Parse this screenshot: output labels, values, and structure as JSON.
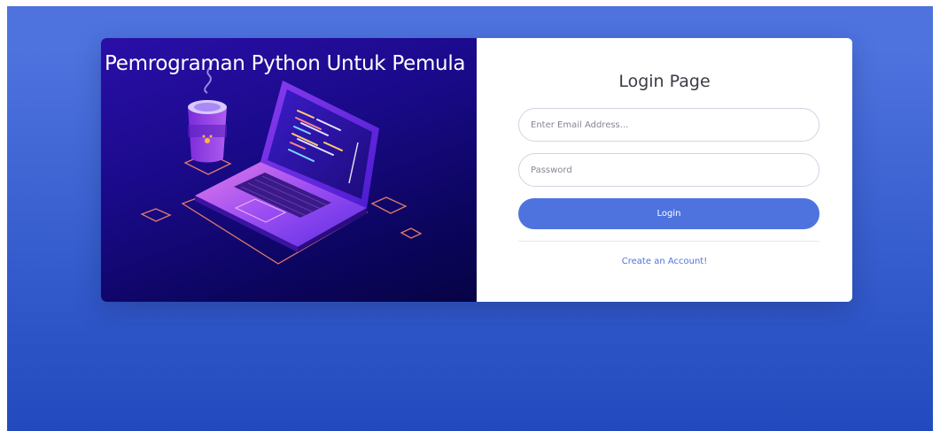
{
  "hero": {
    "title": "Pemrograman Python Untuk Pemula",
    "illustration": "laptop-and-coffee-cup-isometric"
  },
  "login": {
    "title": "Login Page",
    "email_placeholder": "Enter Email Address...",
    "password_placeholder": "Password",
    "login_label": "Login",
    "create_account_label": "Create an Account!"
  },
  "colors": {
    "page_gradient_top": "#4e73df",
    "page_gradient_bottom": "#224abe",
    "primary": "#4e73df",
    "hero_bg": "#1a0a8a"
  }
}
